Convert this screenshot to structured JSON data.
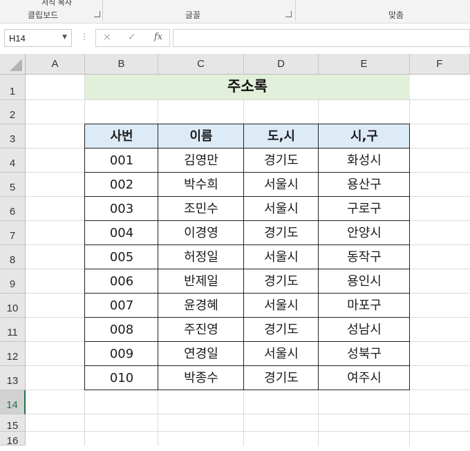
{
  "ribbon": {
    "top_partial": "서식 복사",
    "groups": [
      {
        "label": "클립보드"
      },
      {
        "label": "글꼴"
      },
      {
        "label": "맞춤"
      }
    ]
  },
  "formula_bar": {
    "name_box": "H14",
    "cancel_icon": "×",
    "enter_icon": "✓",
    "function_icon": "fx",
    "formula": ""
  },
  "sheet": {
    "columns": [
      "A",
      "B",
      "C",
      "D",
      "E",
      "F"
    ],
    "rows": [
      "1",
      "2",
      "3",
      "4",
      "5",
      "6",
      "7",
      "8",
      "9",
      "10",
      "11",
      "12",
      "13",
      "14",
      "15",
      "16"
    ],
    "active_row": "14",
    "title": "주소록",
    "table": {
      "headers": [
        "사번",
        "이름",
        "도,시",
        "시,구"
      ],
      "rows": [
        [
          "001",
          "김영만",
          "경기도",
          "화성시"
        ],
        [
          "002",
          "박수희",
          "서울시",
          "용산구"
        ],
        [
          "003",
          "조민수",
          "서울시",
          "구로구"
        ],
        [
          "004",
          "이경영",
          "경기도",
          "안양시"
        ],
        [
          "005",
          "허정일",
          "서울시",
          "동작구"
        ],
        [
          "006",
          "반제일",
          "경기도",
          "용인시"
        ],
        [
          "007",
          "윤경혜",
          "서울시",
          "마포구"
        ],
        [
          "008",
          "주진영",
          "경기도",
          "성남시"
        ],
        [
          "009",
          "연경일",
          "서울시",
          "성북구"
        ],
        [
          "010",
          "박종수",
          "경기도",
          "여주시"
        ]
      ]
    }
  },
  "colors": {
    "title_fill": "#e2efda",
    "header_fill": "#ddebf7",
    "active_accent": "#217346"
  }
}
